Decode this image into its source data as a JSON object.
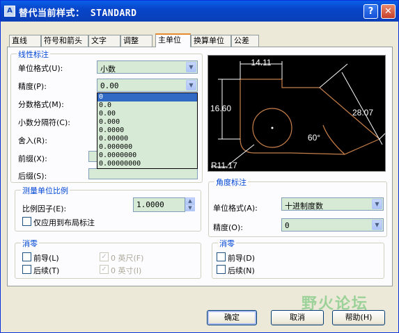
{
  "window": {
    "title": "替代当前样式： STANDARD",
    "help_label": "?",
    "close_label": "✕",
    "app_icon": "A"
  },
  "tabs": [
    {
      "label": "直线"
    },
    {
      "label": "符号和箭头"
    },
    {
      "label": "文字"
    },
    {
      "label": "调整"
    },
    {
      "label": "主单位"
    },
    {
      "label": "换算单位"
    },
    {
      "label": "公差"
    }
  ],
  "active_tab": "主单位",
  "linear": {
    "group_label": "线性标注",
    "unit_format": {
      "label": "单位格式(U):",
      "value": "小数"
    },
    "precision": {
      "label": "精度(P):",
      "value": "0.00"
    },
    "fraction_format": {
      "label": "分数格式(M):"
    },
    "decimal_separator": {
      "label": "小数分隔符(C):"
    },
    "round_off": {
      "label": "舍入(R):"
    },
    "prefix": {
      "label": "前缀(X):"
    },
    "suffix": {
      "label": "后缀(S):"
    },
    "precision_options": [
      "0",
      "0.0",
      "0.00",
      "0.000",
      "0.0000",
      "0.00000",
      "0.000000",
      "0.0000000",
      "0.00000000"
    ],
    "selected_option": "0"
  },
  "scale": {
    "group_label": "测量单位比例",
    "factor_label": "比例因子(E):",
    "factor_value": "1.0000",
    "layout_only_label": "仅应用到布局标注"
  },
  "zero_left": {
    "group_label": "消零",
    "leading": "前导(L)",
    "trailing": "后续(T)",
    "feet": "0 英尺(F)",
    "inches": "0 英寸(I)",
    "feet_checked": "✓",
    "inches_checked": "✓"
  },
  "preview": {
    "dim_top": "14.11",
    "dim_left": "16.60",
    "dim_right": "28.07",
    "dim_angle": "60°",
    "dim_radius": "R11.17"
  },
  "angular": {
    "group_label": "角度标注",
    "unit_format": {
      "label": "单位格式(A):",
      "value": "十进制度数"
    },
    "precision": {
      "label": "精度(O):",
      "value": "0"
    }
  },
  "zero_right": {
    "group_label": "消零",
    "leading": "前导(D)",
    "trailing": "后续(N)"
  },
  "buttons": {
    "ok": "确定",
    "cancel": "取消",
    "help": "帮助(H)"
  },
  "watermark": "野火论坛",
  "colors": {
    "titlebar": "#0a3fb8",
    "group_label": "#0046d5",
    "field_bg": "#d6ead6",
    "selected": "#316ac5",
    "preview_geometry": "#c8804a"
  }
}
